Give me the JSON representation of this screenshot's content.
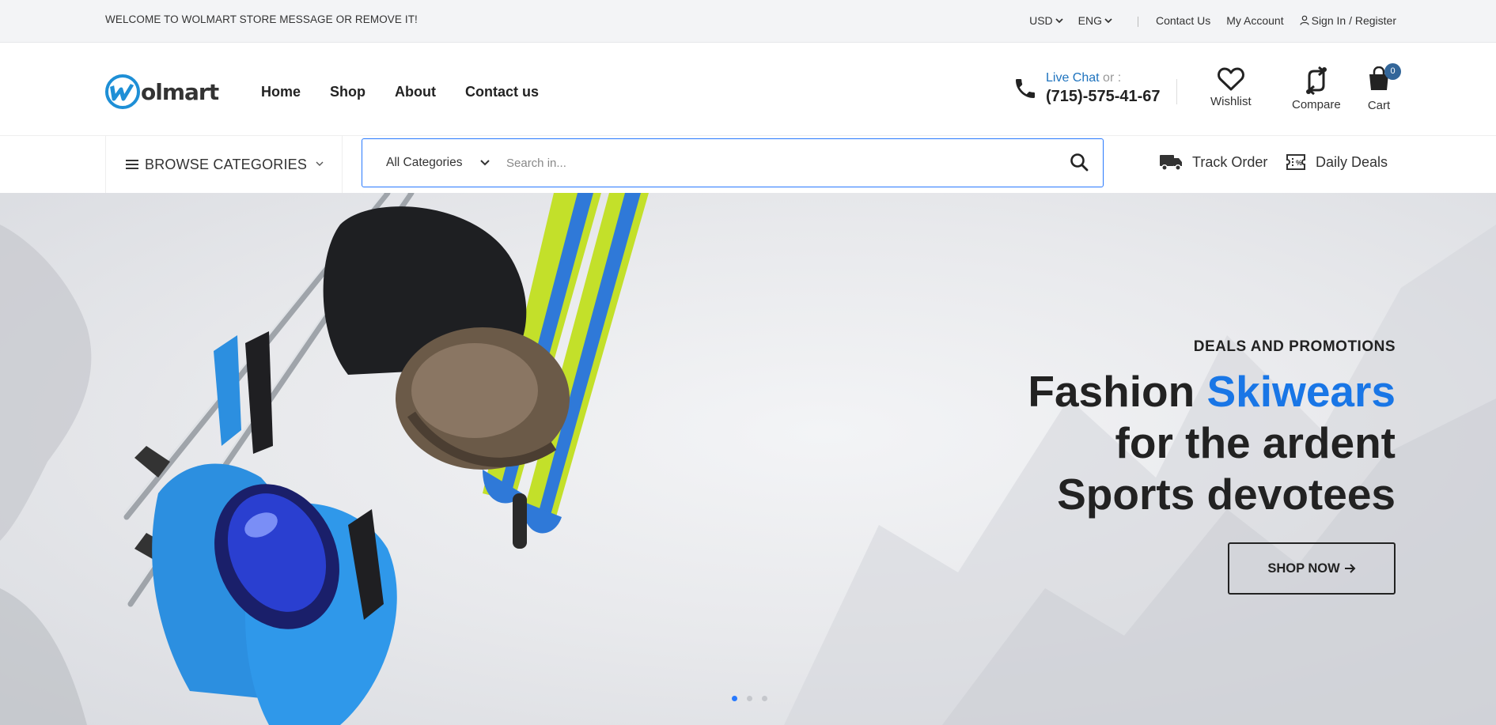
{
  "topbar": {
    "welcome": "WELCOME TO WOLMART STORE MESSAGE OR REMOVE IT!",
    "currency": "USD",
    "language": "ENG",
    "contact_us": "Contact Us",
    "my_account": "My Account",
    "sign_in": "Sign In / Register"
  },
  "header": {
    "logo_text": "olmart",
    "nav": [
      "Home",
      "Shop",
      "About",
      "Contact us"
    ],
    "live_chat": "Live Chat",
    "or": "or :",
    "phone": "(715)-575-41-67",
    "wishlist": "Wishlist",
    "compare": "Compare",
    "cart": "Cart",
    "cart_count": "0"
  },
  "navrow": {
    "browse_categories": "BROWSE CATEGORIES",
    "search_category": "All Categories",
    "search_placeholder": "Search in...",
    "track_order": "Track Order",
    "daily_deals": "Daily Deals"
  },
  "hero": {
    "subtitle": "DEALS AND PROMOTIONS",
    "title_part1": "Fashion ",
    "title_highlight": "Skiwears",
    "title_line2": "for the ardent",
    "title_line3": "Sports devotees",
    "button": "SHOP NOW",
    "slides": 3,
    "active_slide": 1
  },
  "colors": {
    "accent": "#2879fe",
    "highlight": "#1976e6",
    "live_chat": "#1e73be",
    "badge": "#336699"
  }
}
